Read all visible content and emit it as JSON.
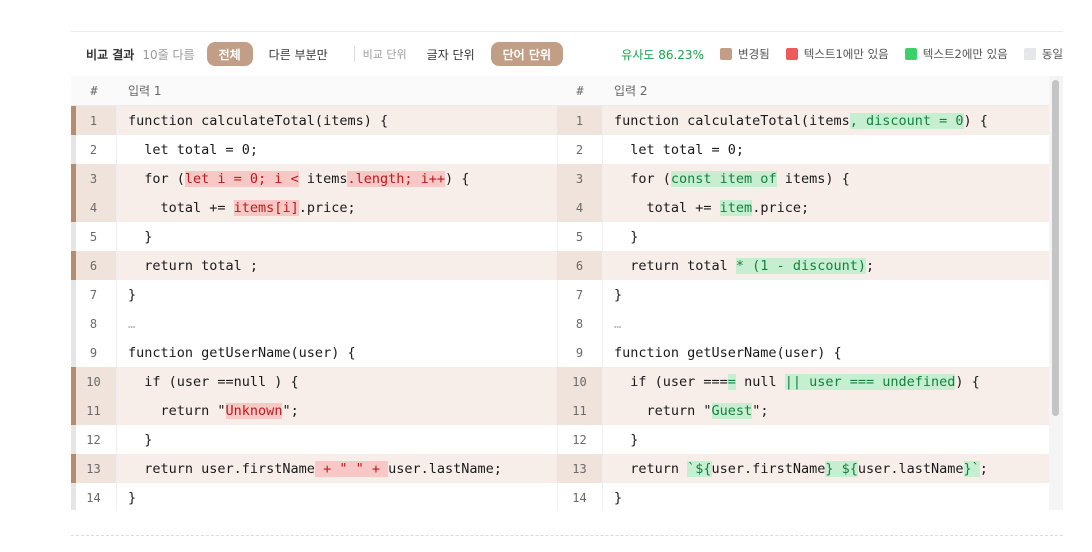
{
  "toolbar": {
    "title": "비교 결과",
    "diff_count": "10줄 다름",
    "view_all": "전체",
    "view_diff_only": "다른 부분만",
    "compare_unit_label": "비교 단위",
    "char_unit": "글자 단위",
    "word_unit": "단어 단위",
    "similarity": "유사도 86.23%",
    "legend": {
      "changed": "변경됨",
      "only_text1": "텍스트1에만 있음",
      "only_text2": "텍스트2에만 있음",
      "same": "동일"
    },
    "colors": {
      "changed": "#c29e86",
      "only_text1": "#ef5b5b",
      "only_text2": "#3ccf6a",
      "same": "#e5e7eb"
    }
  },
  "left": {
    "header_num": "#",
    "header_label": "입력 1",
    "rows": [
      {
        "n": "1",
        "changed": true,
        "segs": [
          {
            "t": "function calculateTotal(items) {"
          }
        ]
      },
      {
        "n": "2",
        "changed": false,
        "segs": [
          {
            "t": "  let total = 0;"
          }
        ]
      },
      {
        "n": "3",
        "changed": true,
        "segs": [
          {
            "t": "  for ("
          },
          {
            "t": "let i = 0; i <",
            "k": "del"
          },
          {
            "t": " items"
          },
          {
            "t": ".length; i++",
            "k": "del"
          },
          {
            "t": ") {"
          }
        ]
      },
      {
        "n": "4",
        "changed": true,
        "segs": [
          {
            "t": "    total += "
          },
          {
            "t": "items[i]",
            "k": "del"
          },
          {
            "t": ".price;"
          }
        ]
      },
      {
        "n": "5",
        "changed": false,
        "segs": [
          {
            "t": "  }"
          }
        ]
      },
      {
        "n": "6",
        "changed": true,
        "segs": [
          {
            "t": "  return total ;"
          }
        ]
      },
      {
        "n": "7",
        "changed": false,
        "segs": [
          {
            "t": "}"
          }
        ]
      },
      {
        "n": "8",
        "changed": false,
        "ellipsis": true,
        "segs": [
          {
            "t": "…"
          }
        ]
      },
      {
        "n": "9",
        "changed": false,
        "segs": [
          {
            "t": "function getUserName(user) {"
          }
        ]
      },
      {
        "n": "10",
        "changed": true,
        "segs": [
          {
            "t": "  if (user ==null ) {"
          }
        ]
      },
      {
        "n": "11",
        "changed": true,
        "segs": [
          {
            "t": "    return \""
          },
          {
            "t": "Unknown",
            "k": "del"
          },
          {
            "t": "\";"
          }
        ]
      },
      {
        "n": "12",
        "changed": false,
        "segs": [
          {
            "t": "  }"
          }
        ]
      },
      {
        "n": "13",
        "changed": true,
        "segs": [
          {
            "t": "  return user.firstName"
          },
          {
            "t": " + \" \" + ",
            "k": "del"
          },
          {
            "t": "user.lastName;"
          }
        ]
      },
      {
        "n": "14",
        "changed": false,
        "segs": [
          {
            "t": "}"
          }
        ]
      }
    ]
  },
  "right": {
    "header_num": "#",
    "header_label": "입력 2",
    "rows": [
      {
        "n": "1",
        "changed": true,
        "segs": [
          {
            "t": "function calculateTotal(items"
          },
          {
            "t": ", discount = 0",
            "k": "add"
          },
          {
            "t": ") {"
          }
        ]
      },
      {
        "n": "2",
        "changed": false,
        "segs": [
          {
            "t": "  let total = 0;"
          }
        ]
      },
      {
        "n": "3",
        "changed": true,
        "segs": [
          {
            "t": "  for ("
          },
          {
            "t": "const item of",
            "k": "add"
          },
          {
            "t": " items) {"
          }
        ]
      },
      {
        "n": "4",
        "changed": true,
        "segs": [
          {
            "t": "    total += "
          },
          {
            "t": "item",
            "k": "add"
          },
          {
            "t": ".price;"
          }
        ]
      },
      {
        "n": "5",
        "changed": false,
        "segs": [
          {
            "t": "  }"
          }
        ]
      },
      {
        "n": "6",
        "changed": true,
        "segs": [
          {
            "t": "  return total "
          },
          {
            "t": "* (1 - discount)",
            "k": "add"
          },
          {
            "t": ";"
          }
        ]
      },
      {
        "n": "7",
        "changed": false,
        "segs": [
          {
            "t": "}"
          }
        ]
      },
      {
        "n": "8",
        "changed": false,
        "ellipsis": true,
        "segs": [
          {
            "t": "…"
          }
        ]
      },
      {
        "n": "9",
        "changed": false,
        "segs": [
          {
            "t": "function getUserName(user) {"
          }
        ]
      },
      {
        "n": "10",
        "changed": true,
        "segs": [
          {
            "t": "  if (user ==="
          },
          {
            "t": "=",
            "k": "add"
          },
          {
            "t": " null "
          },
          {
            "t": "|| user === undefined",
            "k": "add"
          },
          {
            "t": ") {"
          }
        ]
      },
      {
        "n": "11",
        "changed": true,
        "segs": [
          {
            "t": "    return \""
          },
          {
            "t": "Guest",
            "k": "add"
          },
          {
            "t": "\";"
          }
        ]
      },
      {
        "n": "12",
        "changed": false,
        "segs": [
          {
            "t": "  }"
          }
        ]
      },
      {
        "n": "13",
        "changed": true,
        "segs": [
          {
            "t": "  return "
          },
          {
            "t": "`${",
            "k": "add"
          },
          {
            "t": "user.firstName"
          },
          {
            "t": "} ${",
            "k": "add"
          },
          {
            "t": "user.lastName"
          },
          {
            "t": "}`",
            "k": "add"
          },
          {
            "t": ";"
          }
        ]
      },
      {
        "n": "14",
        "changed": false,
        "segs": [
          {
            "t": "}"
          }
        ]
      }
    ]
  }
}
